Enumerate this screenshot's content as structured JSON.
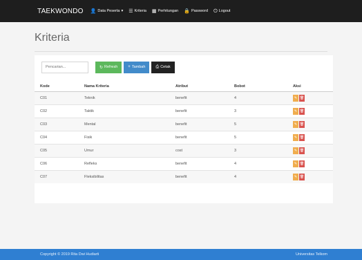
{
  "navbar": {
    "brand": "TAEKWONDO",
    "items": [
      {
        "label": "Data Peserta",
        "icon": "user-icon",
        "glyph": "👤",
        "has_dropdown": true
      },
      {
        "label": "Kriteria",
        "icon": "list-icon",
        "glyph": "☰"
      },
      {
        "label": "Perhitungan",
        "icon": "calculator-icon",
        "glyph": "▦"
      },
      {
        "label": "Password",
        "icon": "lock-icon",
        "glyph": "🔒"
      },
      {
        "label": "Logout",
        "icon": "power-icon",
        "glyph": "⏻"
      }
    ]
  },
  "page": {
    "title": "Kriteria"
  },
  "toolbar": {
    "search_placeholder": "Pencarian...",
    "refresh_label": "Refresh",
    "tambah_label": "Tambah",
    "cetak_label": "Cetak"
  },
  "table": {
    "headers": [
      "Kode",
      "Nama Kriteria",
      "Atribut",
      "Bobot",
      "Aksi"
    ],
    "rows": [
      {
        "kode": "C01",
        "nama": "Teknik",
        "atribut": "benefit",
        "bobot": "4"
      },
      {
        "kode": "C02",
        "nama": "Taktik",
        "atribut": "benefit",
        "bobot": "3"
      },
      {
        "kode": "C03",
        "nama": "Mental",
        "atribut": "benefit",
        "bobot": "5"
      },
      {
        "kode": "C04",
        "nama": "Fisik",
        "atribut": "benefit",
        "bobot": "5"
      },
      {
        "kode": "C05",
        "nama": "Umur",
        "atribut": "cost",
        "bobot": "3"
      },
      {
        "kode": "C06",
        "nama": "Refleks",
        "atribut": "benefit",
        "bobot": "4"
      },
      {
        "kode": "C07",
        "nama": "Fleksibilitas",
        "atribut": "benefit",
        "bobot": "4"
      }
    ]
  },
  "footer": {
    "copyright": "Copyright © 2019 Rita Dwi Hudiarti",
    "university": "Universitas Telkom"
  },
  "colors": {
    "navbar": "#1e1e1e",
    "refresh_button": "#5cb85c",
    "tambah_button": "#428bca",
    "cetak_button": "#222222",
    "edit_action": "#f0ad4e",
    "delete_action": "#d9534f",
    "footer": "#2f7fd2"
  }
}
